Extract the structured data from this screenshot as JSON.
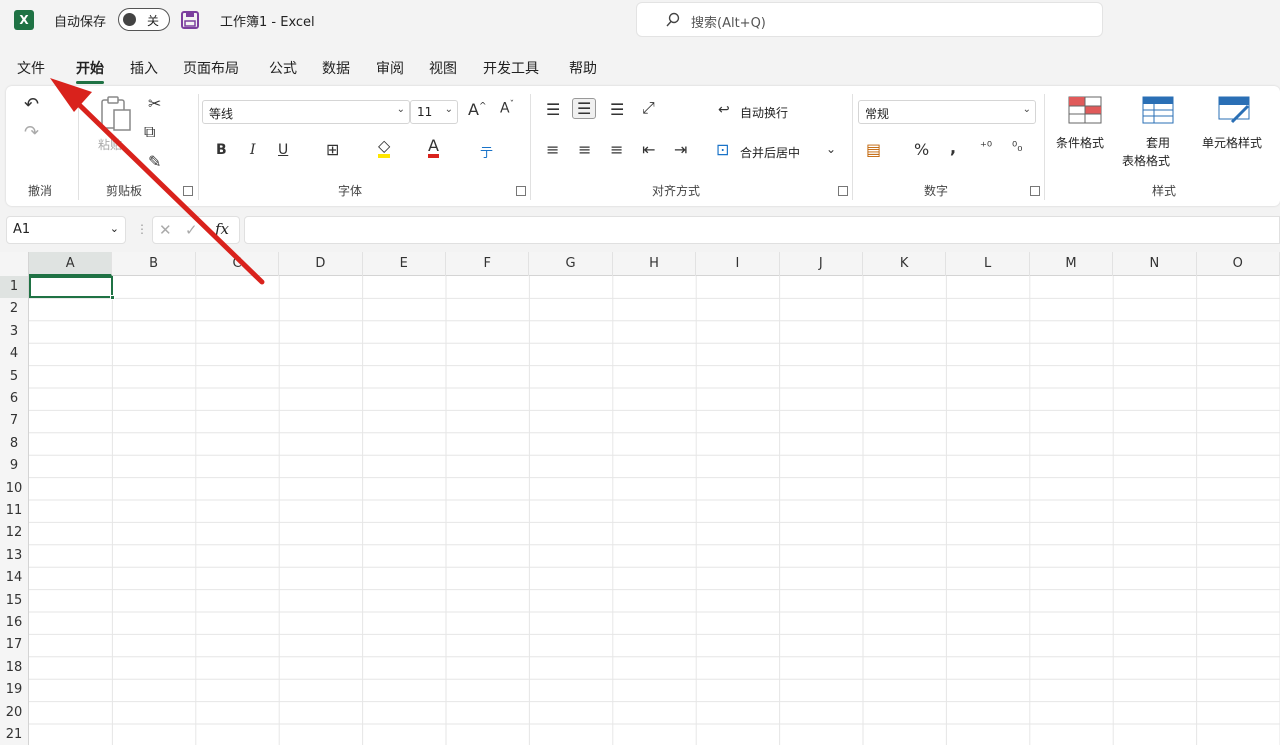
{
  "titlebar": {
    "app_icon": "excel-icon",
    "autosave_label": "自动保存",
    "autosave_state": "关",
    "doc_title": "工作簿1  -  Excel",
    "search_placeholder": "搜索(Alt+Q)"
  },
  "tabs": [
    "文件",
    "开始",
    "插入",
    "页面布局",
    "公式",
    "数据",
    "审阅",
    "视图",
    "开发工具",
    "帮助"
  ],
  "active_tab": "开始",
  "ribbon": {
    "groups": {
      "undo": "撤消",
      "clipboard": "剪贴板",
      "font": "字体",
      "alignment": "对齐方式",
      "number": "数字",
      "styles": "样式"
    },
    "clipboard_paste": "粘贴",
    "font_name": "等线",
    "font_size": "11",
    "wrap_text": "自动换行",
    "merge_center": "合并后居中",
    "number_format": "常规",
    "conditional_format": "条件格式",
    "table_format_1": "套用",
    "table_format_2": "表格格式",
    "cell_styles": "单元格样式",
    "bold": "B",
    "italic": "I",
    "underline": "U",
    "percent": "%",
    "comma": ","
  },
  "formula_bar": {
    "name_box": "A1",
    "fx": "fx",
    "formula": ""
  },
  "grid": {
    "columns": [
      "A",
      "B",
      "C",
      "D",
      "E",
      "F",
      "G",
      "H",
      "I",
      "J",
      "K",
      "L",
      "M",
      "N",
      "O"
    ],
    "rows": [
      "1",
      "2",
      "3",
      "4",
      "5",
      "6",
      "7",
      "8",
      "9",
      "10",
      "11",
      "12",
      "13",
      "14",
      "15",
      "16",
      "17",
      "18",
      "19",
      "20",
      "21"
    ],
    "active_cell": "A1"
  },
  "colors": {
    "accent": "#1f7244",
    "arrow": "#d9221c"
  }
}
